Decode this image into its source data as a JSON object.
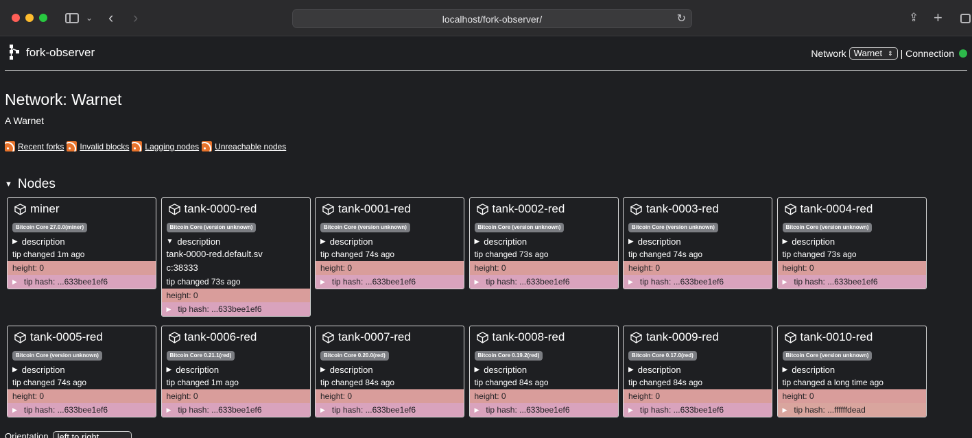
{
  "browser": {
    "url": "localhost/fork-observer/"
  },
  "header": {
    "app_name": "fork-observer",
    "network_label": "Network",
    "network_selected": "Warnet",
    "connection_label": "| Connection",
    "connection_color": "#2db84a"
  },
  "page": {
    "title": "Network: Warnet",
    "subtitle": "A Warnet",
    "feeds": [
      "Recent forks",
      "Invalid blocks",
      "Lagging nodes",
      "Unreachable nodes"
    ],
    "nodes_heading": "Nodes",
    "orientation_label": "Orientation",
    "orientation_value": "left to right"
  },
  "nodes": [
    {
      "name": "miner",
      "version": "Bitcoin Core 27.0.0(miner)",
      "description_label": "description",
      "tip_changed": "tip changed 1m ago",
      "height": "height: 0",
      "tip_hash": "tip hash: ...633bee1ef6"
    },
    {
      "name": "tank-0000-red",
      "version": "Bitcoin Core (version unknown)",
      "description_label": "description",
      "description_text": "tank-0000-red.default.svc:38333",
      "tip_changed": "tip changed 73s ago",
      "height": "height: 0",
      "tip_hash": "tip hash: ...633bee1ef6"
    },
    {
      "name": "tank-0001-red",
      "version": "Bitcoin Core (version unknown)",
      "description_label": "description",
      "tip_changed": "tip changed 74s ago",
      "height": "height: 0",
      "tip_hash": "tip hash: ...633bee1ef6"
    },
    {
      "name": "tank-0002-red",
      "version": "Bitcoin Core (version unknown)",
      "description_label": "description",
      "tip_changed": "tip changed 73s ago",
      "height": "height: 0",
      "tip_hash": "tip hash: ...633bee1ef6"
    },
    {
      "name": "tank-0003-red",
      "version": "Bitcoin Core (version unknown)",
      "description_label": "description",
      "tip_changed": "tip changed 74s ago",
      "height": "height: 0",
      "tip_hash": "tip hash: ...633bee1ef6"
    },
    {
      "name": "tank-0004-red",
      "version": "Bitcoin Core (version unknown)",
      "description_label": "description",
      "tip_changed": "tip changed 73s ago",
      "height": "height: 0",
      "tip_hash": "tip hash: ...633bee1ef6"
    },
    {
      "name": "tank-0005-red",
      "version": "Bitcoin Core (version unknown)",
      "description_label": "description",
      "tip_changed": "tip changed 74s ago",
      "height": "height: 0",
      "tip_hash": "tip hash: ...633bee1ef6"
    },
    {
      "name": "tank-0006-red",
      "version": "Bitcoin Core 0.21.1(red)",
      "description_label": "description",
      "tip_changed": "tip changed 1m ago",
      "height": "height: 0",
      "tip_hash": "tip hash: ...633bee1ef6"
    },
    {
      "name": "tank-0007-red",
      "version": "Bitcoin Core 0.20.0(red)",
      "description_label": "description",
      "tip_changed": "tip changed 84s ago",
      "height": "height: 0",
      "tip_hash": "tip hash: ...633bee1ef6"
    },
    {
      "name": "tank-0008-red",
      "version": "Bitcoin Core 0.19.2(red)",
      "description_label": "description",
      "tip_changed": "tip changed 84s ago",
      "height": "height: 0",
      "tip_hash": "tip hash: ...633bee1ef6"
    },
    {
      "name": "tank-0009-red",
      "version": "Bitcoin Core 0.17.0(red)",
      "description_label": "description",
      "tip_changed": "tip changed 84s ago",
      "height": "height: 0",
      "tip_hash": "tip hash: ...633bee1ef6"
    },
    {
      "name": "tank-0010-red",
      "version": "Bitcoin Core (version unknown)",
      "description_label": "description",
      "tip_changed": "tip changed a long time ago",
      "height": "height: 0",
      "tip_hash": "tip hash: ...ffffffdead"
    }
  ]
}
